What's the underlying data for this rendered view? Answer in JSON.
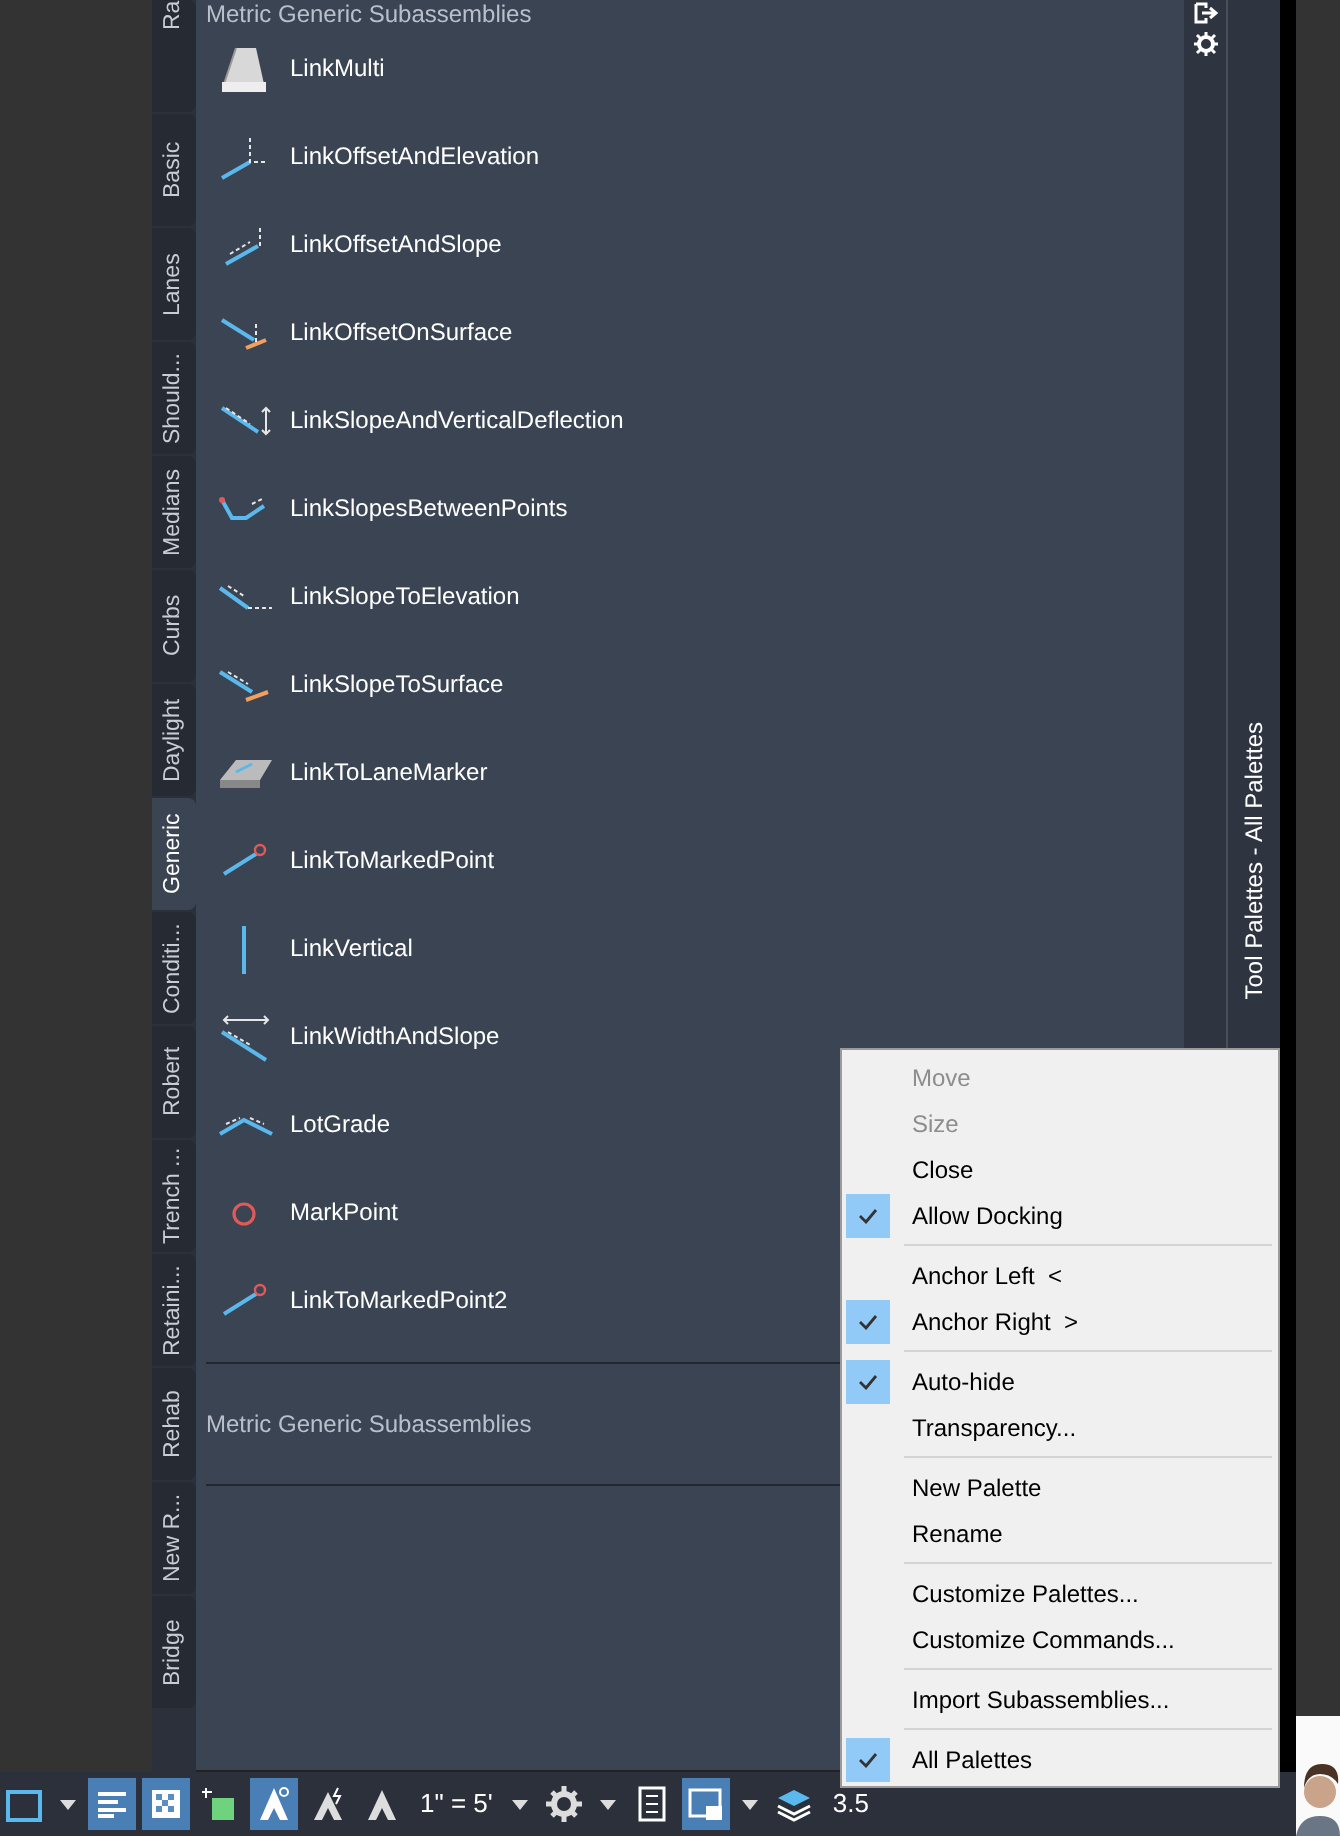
{
  "tabs": [
    {
      "label": "Ra",
      "selected": false
    },
    {
      "label": "Basic",
      "selected": false
    },
    {
      "label": "Lanes",
      "selected": false
    },
    {
      "label": "Should...",
      "selected": false
    },
    {
      "label": "Medians",
      "selected": false
    },
    {
      "label": "Curbs",
      "selected": false
    },
    {
      "label": "Daylight",
      "selected": false
    },
    {
      "label": "Generic",
      "selected": true
    },
    {
      "label": "Conditi...",
      "selected": false
    },
    {
      "label": "Robert",
      "selected": false
    },
    {
      "label": "Trench ...",
      "selected": false
    },
    {
      "label": "Retaini...",
      "selected": false
    },
    {
      "label": "Rehab",
      "selected": false
    },
    {
      "label": "New R...",
      "selected": false
    },
    {
      "label": "Bridge",
      "selected": false
    }
  ],
  "palette": {
    "header": "Metric Generic Subassemblies",
    "items": [
      "LinkMulti",
      "LinkOffsetAndElevation",
      "LinkOffsetAndSlope",
      "LinkOffsetOnSurface",
      "LinkSlopeAndVerticalDeflection",
      "LinkSlopesBetweenPoints",
      "LinkSlopeToElevation",
      "LinkSlopeToSurface",
      "LinkToLaneMarker",
      "LinkToMarkedPoint",
      "LinkVertical",
      "LinkWidthAndSlope",
      "LotGrade",
      "MarkPoint",
      "LinkToMarkedPoint2"
    ],
    "footer": "Metric Generic Subassemblies"
  },
  "palette_title": "Tool Palettes - All Palettes",
  "context_menu": [
    {
      "kind": "item",
      "label": "Move",
      "disabled": true,
      "checked": false
    },
    {
      "kind": "item",
      "label": "Size",
      "disabled": true,
      "checked": false
    },
    {
      "kind": "item",
      "label": "Close",
      "disabled": false,
      "checked": false
    },
    {
      "kind": "item",
      "label": "Allow Docking",
      "disabled": false,
      "checked": true
    },
    {
      "kind": "separator"
    },
    {
      "kind": "item",
      "label": "Anchor Left  <",
      "disabled": false,
      "checked": false
    },
    {
      "kind": "item",
      "label": "Anchor Right  >",
      "disabled": false,
      "checked": true
    },
    {
      "kind": "separator"
    },
    {
      "kind": "item",
      "label": "Auto-hide",
      "disabled": false,
      "checked": true
    },
    {
      "kind": "item",
      "label": "Transparency...",
      "disabled": false,
      "checked": false
    },
    {
      "kind": "separator"
    },
    {
      "kind": "item",
      "label": "New Palette",
      "disabled": false,
      "checked": false
    },
    {
      "kind": "item",
      "label": "Rename",
      "disabled": false,
      "checked": false
    },
    {
      "kind": "separator"
    },
    {
      "kind": "item",
      "label": "Customize Palettes...",
      "disabled": false,
      "checked": false
    },
    {
      "kind": "item",
      "label": "Customize Commands...",
      "disabled": false,
      "checked": false
    },
    {
      "kind": "separator"
    },
    {
      "kind": "item",
      "label": "Import Subassemblies...",
      "disabled": false,
      "checked": false
    },
    {
      "kind": "separator"
    },
    {
      "kind": "item",
      "label": "All Palettes",
      "disabled": false,
      "checked": true
    }
  ],
  "status_bar": [
    {
      "kind": "viewport",
      "on": false
    },
    {
      "kind": "dropdown"
    },
    {
      "kind": "lineweight",
      "on": true
    },
    {
      "kind": "transparency",
      "on": true
    },
    {
      "kind": "selection",
      "on": false
    },
    {
      "kind": "annotation",
      "on": true
    },
    {
      "kind": "annotation-alt",
      "on": false
    },
    {
      "kind": "annotation-plain",
      "on": false
    },
    {
      "kind": "text",
      "label": "1\" = 5'"
    },
    {
      "kind": "dropdown"
    },
    {
      "kind": "gear",
      "on": false
    },
    {
      "kind": "dropdown"
    },
    {
      "kind": "properties",
      "on": false
    },
    {
      "kind": "lock",
      "on": true
    },
    {
      "kind": "dropdown"
    },
    {
      "kind": "isolate",
      "on": false
    },
    {
      "kind": "text",
      "label": "3.5"
    }
  ]
}
